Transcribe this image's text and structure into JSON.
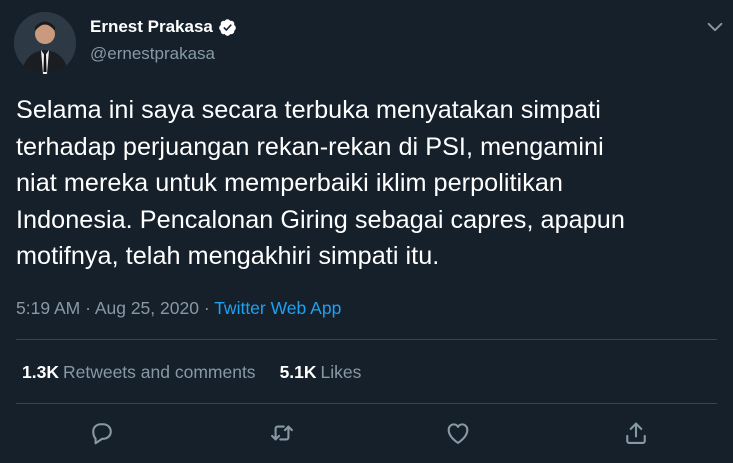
{
  "user": {
    "display_name": "Ernest Prakasa",
    "handle": "@ernestprakasa",
    "verified": true
  },
  "tweet": {
    "text": "Selama ini saya secara terbuka menyatakan simpati\nterhadap perjuangan rekan-rekan di PSI, mengamini\nniat mereka untuk memperbaiki iklim perpolitikan\nIndonesia. Pencalonan Giring sebagai capres, apapun\nmotifnya, telah mengakhiri simpati itu.",
    "time": "5:19 AM",
    "date": "Aug 25, 2020",
    "separator": "·",
    "source": "Twitter Web App"
  },
  "stats": {
    "retweets_count": "1.3K",
    "retweets_label": "Retweets and comments",
    "likes_count": "5.1K",
    "likes_label": "Likes"
  },
  "actions": [
    "reply-icon",
    "retweet-icon",
    "like-icon",
    "share-icon"
  ],
  "colors": {
    "background": "#15202b",
    "text": "#ffffff",
    "secondary": "#8899a6",
    "accent": "#1da1f2",
    "divider": "#38444d"
  }
}
